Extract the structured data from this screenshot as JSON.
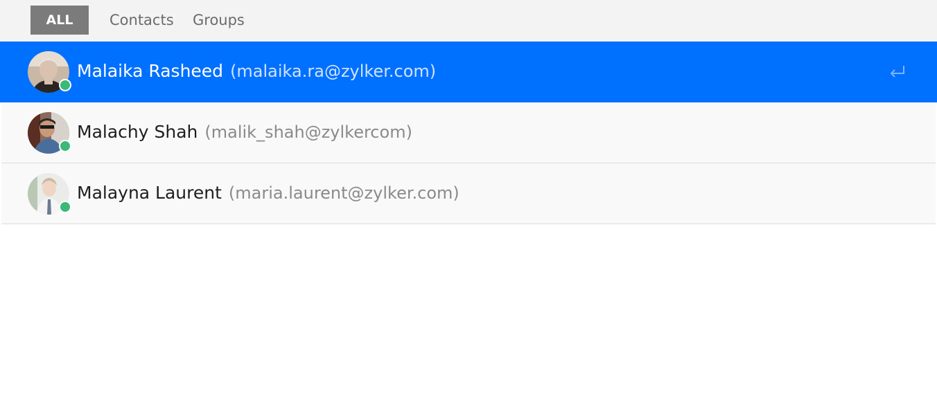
{
  "tabs": [
    {
      "label": "ALL",
      "active": true
    },
    {
      "label": "Contacts",
      "active": false
    },
    {
      "label": "Groups",
      "active": false
    }
  ],
  "contacts": [
    {
      "name": "Malaika Rasheed",
      "email": "(malaika.ra@zylker.com)",
      "status": "online",
      "selected": true
    },
    {
      "name": "Malachy Shah",
      "email": "(malik_shah@zylkercom)",
      "status": "online",
      "selected": false
    },
    {
      "name": "Malayna Laurent",
      "email": "(maria.laurent@zylker.com)",
      "status": "online",
      "selected": false
    }
  ],
  "colors": {
    "accent": "#0070ff",
    "online": "#3cb878",
    "tab_active_bg": "#7b7b7b"
  },
  "icons": {
    "enter": "enter-return-icon"
  }
}
